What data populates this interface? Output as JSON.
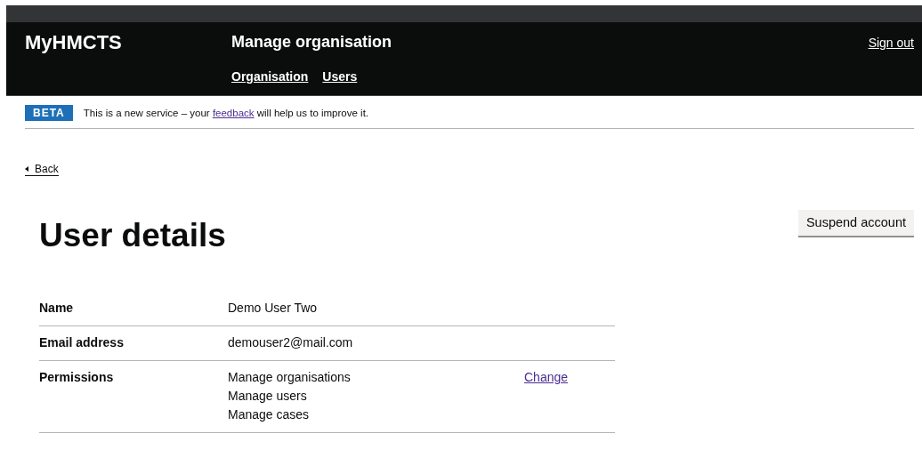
{
  "header": {
    "logo": "MyHMCTS",
    "service_name": "Manage organisation",
    "nav": [
      {
        "label": "Organisation"
      },
      {
        "label": "Users"
      }
    ],
    "sign_out": "Sign out"
  },
  "phase_banner": {
    "tag": "BETA",
    "text_before": "This is a new service – your",
    "link": "feedback",
    "text_after": "will help us to improve it."
  },
  "back_link": "Back",
  "heading": "User details",
  "suspend_button": "Suspend account",
  "summary": [
    {
      "key": "Name",
      "values": [
        "Demo User Two"
      ]
    },
    {
      "key": "Email address",
      "values": [
        "demouser2@mail.com"
      ]
    },
    {
      "key": "Permissions",
      "values": [
        "Manage organisations",
        "Manage users",
        "Manage cases"
      ],
      "action": "Change"
    }
  ]
}
